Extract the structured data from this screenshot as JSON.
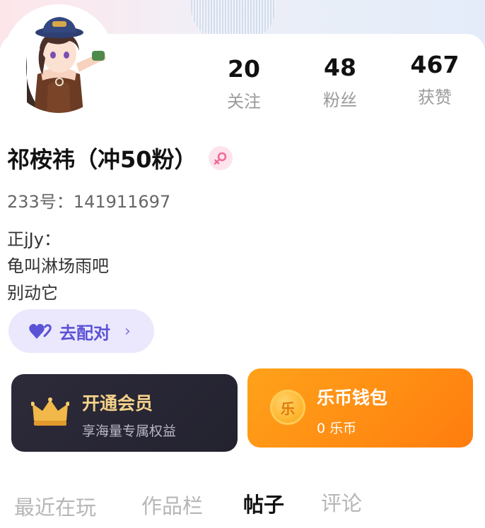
{
  "profile": {
    "name": "祁桉祎（冲50粉）",
    "uid_text": "233号：141911697",
    "bio_lines": [
      "正jJy：",
      "龟叫淋场雨吧",
      "别动它"
    ]
  },
  "stats": [
    {
      "value": "20",
      "label": "关注"
    },
    {
      "value": "48",
      "label": "粉丝"
    },
    {
      "value": "467",
      "label": "获赞"
    }
  ],
  "match_button": {
    "label": "去配对",
    "chevron": "›"
  },
  "vip": {
    "title": "开通会员",
    "subtitle": "享海量专属权益",
    "icon": "crown-icon"
  },
  "wallet": {
    "title": "乐币钱包",
    "subtitle": "0 乐币",
    "coin_char": "乐",
    "icon": "coin-icon"
  },
  "tabs": [
    {
      "label": "最近在玩",
      "active": false
    },
    {
      "label": "作品栏",
      "active": false
    },
    {
      "label": "帖子",
      "active": true
    },
    {
      "label": "评论",
      "active": false
    }
  ],
  "colors": {
    "accent_purple": "#5b53d6",
    "wallet_orange": "#ff8a12",
    "vip_dark": "#2a2836",
    "gold_text": "#f4d28a",
    "gender_pink": "#f06a9a"
  }
}
